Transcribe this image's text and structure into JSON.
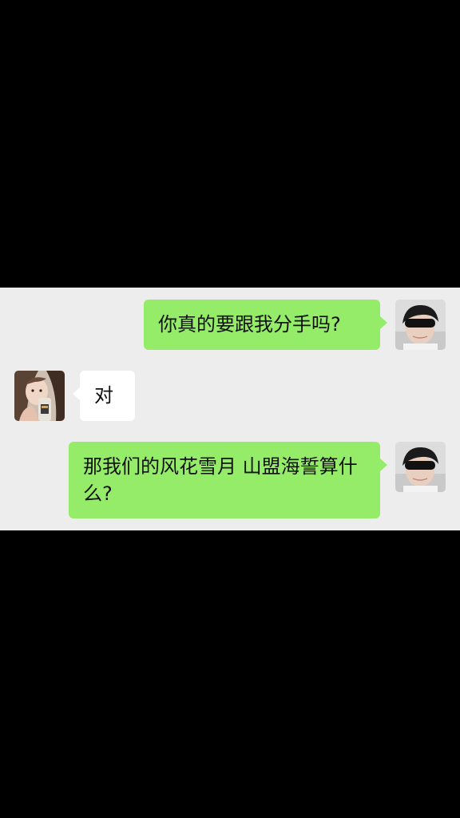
{
  "chat": {
    "messages": [
      {
        "sender": "me",
        "text": "你真的要跟我分手吗?"
      },
      {
        "sender": "other",
        "text": "对"
      },
      {
        "sender": "me",
        "text": "那我们的风花雪月 山盟海誓算什么?"
      }
    ]
  },
  "colors": {
    "outgoing_bubble": "#95ec69",
    "incoming_bubble": "#ffffff",
    "chat_background": "#ededed",
    "letterbox": "#000000"
  },
  "icons": {
    "my_avatar": "avatar-sleeping-man-eye-mask",
    "contact_avatar": "avatar-woman-with-bottle"
  }
}
